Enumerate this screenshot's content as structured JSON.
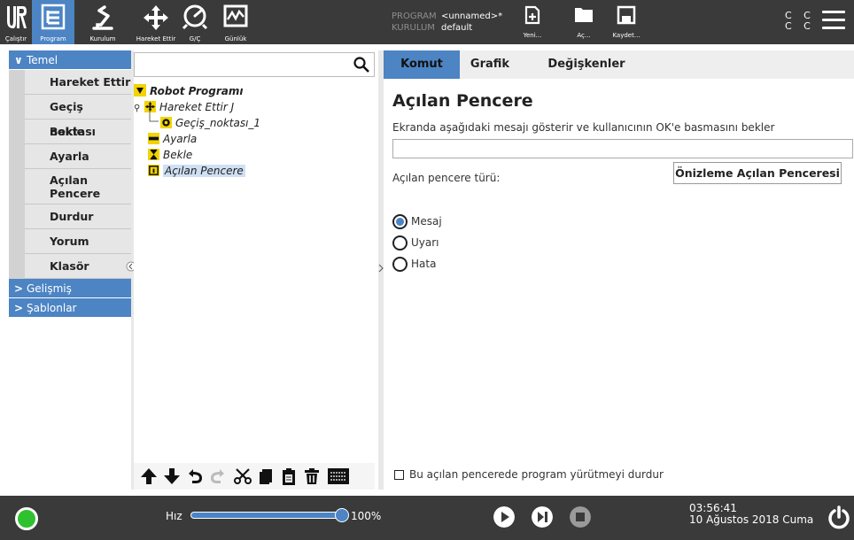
{
  "nav": {
    "items": [
      {
        "label": "Çalıştır"
      },
      {
        "label": "Program"
      },
      {
        "label": "Kurulum"
      },
      {
        "label": "Hareket Ettir"
      },
      {
        "label": "G/Ç"
      },
      {
        "label": "Günlük"
      }
    ],
    "active": "Program"
  },
  "program_info": {
    "program_key": "PROGRAM",
    "program_value": "<unnamed>*",
    "install_key": "KURULUM",
    "install_value": "default"
  },
  "file_buttons": {
    "new": "Yeni...",
    "open": "Aç...",
    "save": "Kaydet..."
  },
  "cc": {
    "line1": "C C",
    "line2": "C C"
  },
  "left": {
    "categories": {
      "basic": "Temel",
      "advanced": "Gelişmiş",
      "templates": "Şablonlar"
    },
    "items": [
      "Hareket Ettir",
      "Geçiş noktası",
      "Bekle",
      "Ayarla",
      "Açılan Pencere",
      "Durdur",
      "Yorum",
      "Klasör"
    ]
  },
  "tree": {
    "root": "Robot Programı",
    "nodes": [
      "Hareket Ettir J",
      "Geçiş_noktası_1",
      "Ayarla",
      "Bekle",
      "Açılan Pencere"
    ]
  },
  "search": {
    "value": ""
  },
  "right": {
    "tabs": [
      "Komut",
      "Grafik",
      "Değişkenler"
    ],
    "active_tab": "Komut",
    "title": "Açılan Pencere",
    "description": "Ekranda aşağıdaki mesajı gösterir ve kullanıcının OK'e basmasını bekler",
    "message_value": "",
    "preview_button": "Önizleme Açılan Penceresi",
    "type_label": "Açılan pencere türü:",
    "types": [
      "Mesaj",
      "Uyarı",
      "Hata"
    ],
    "selected_type": "Mesaj",
    "stop_checkbox": "Bu açılan pencerede program yürütmeyi durdur",
    "stop_checked": false
  },
  "footer": {
    "speed_label": "Hız",
    "speed_value": "100%",
    "speed_fraction": 1.0,
    "time": "03:56:41",
    "date": "10 Ağustos 2018 Cuma"
  },
  "colors": {
    "accent": "#4c84c4",
    "bar": "#3a3a3a",
    "highlight_yellow": "#f2d400",
    "status_green": "#2fc12f"
  }
}
